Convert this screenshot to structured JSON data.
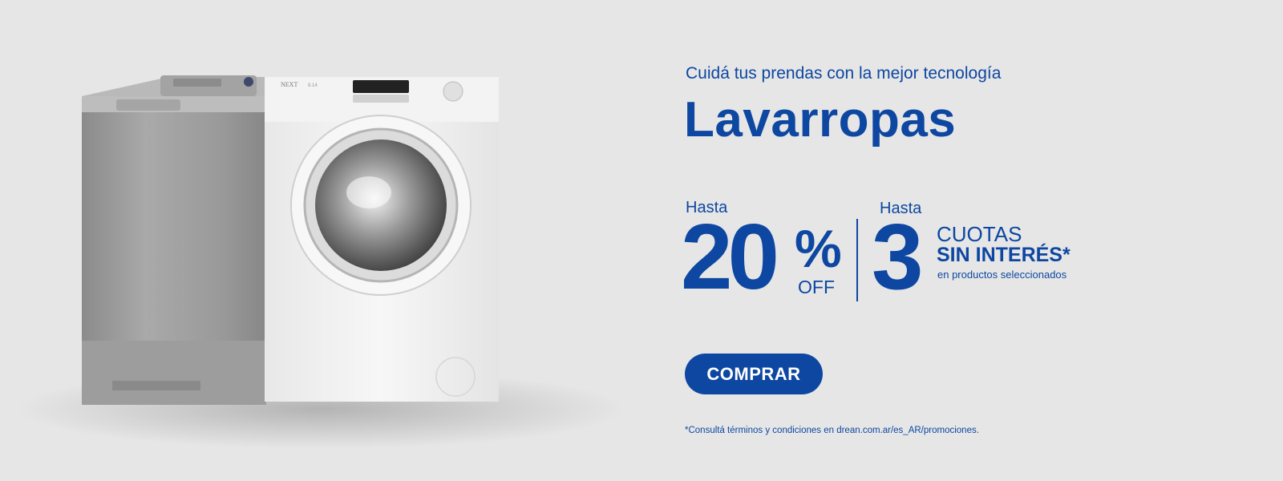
{
  "kicker": "Cuidá tus prendas con la mejor tecnología",
  "headline": "Lavarropas",
  "offer_discount": {
    "label": "Hasta",
    "value": "20",
    "percent_sign": "%",
    "suffix": "OFF"
  },
  "offer_installments": {
    "label": "Hasta",
    "value": "3",
    "line1": "CUOTAS",
    "line2": "SIN INTERÉS*",
    "line3": "en productos seleccionados"
  },
  "cta_label": "COMPRAR",
  "legal_note": "*Consultá términos y condiciones en drean.com.ar/es_AR/promociones.",
  "appliance_labels": {
    "brand_mark": "NEXT",
    "model_text": "8.14"
  },
  "colors": {
    "background": "#e6e6e6",
    "brand_blue": "#0d47a1",
    "button_text": "#ffffff"
  }
}
